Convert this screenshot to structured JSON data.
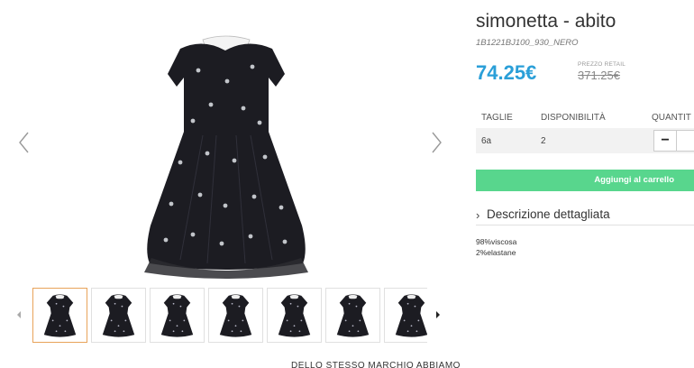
{
  "product": {
    "title": "simonetta - abito",
    "sku": "1B1221BJ100_930_NERO",
    "price": "74.25€",
    "retail_label": "PREZZO RETAIL",
    "retail_price": "371.25€"
  },
  "gallery": {
    "prev_icon": "chevron-left-icon",
    "next_icon": "chevron-right-icon",
    "thumb_count": 7,
    "active_thumb": 0
  },
  "sizes_table": {
    "headers": [
      "TAGLIE",
      "DISPONIBILITÀ",
      "QUANTIT"
    ],
    "rows": [
      {
        "size": "6a",
        "availability": "2",
        "qty_minus": "−"
      }
    ]
  },
  "cart": {
    "add_label": "Aggiungi al carrello"
  },
  "description": {
    "chevron": "›",
    "title": "Descrizione dettagliata",
    "composition": [
      "98%viscosa",
      "2%elastane"
    ]
  },
  "related": {
    "heading": "DELLO STESSO MARCHIO ABBIAMO"
  },
  "colors": {
    "price": "#2a9fd8",
    "cart_button": "#58d68d",
    "active_thumb_border": "#e8a35a",
    "dress": "#1c1c22"
  }
}
